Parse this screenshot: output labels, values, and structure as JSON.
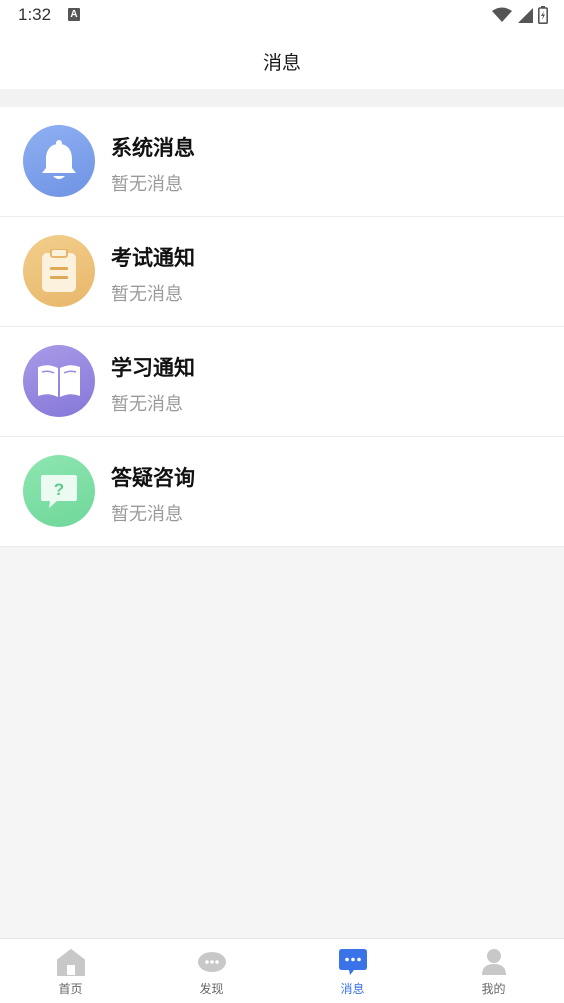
{
  "status_bar": {
    "time": "1:32",
    "notification_icon": "a-notification-icon",
    "icons": [
      "wifi-icon",
      "signal-icon",
      "battery-icon"
    ]
  },
  "header": {
    "title": "消息"
  },
  "messages": [
    {
      "title": "系统消息",
      "subtitle": "暂无消息",
      "icon": "bell-icon",
      "color": "#7b9ee8"
    },
    {
      "title": "考试通知",
      "subtitle": "暂无消息",
      "icon": "clipboard-icon",
      "color": "#edc27a"
    },
    {
      "title": "学习通知",
      "subtitle": "暂无消息",
      "icon": "book-icon",
      "color": "#9386e0"
    },
    {
      "title": "答疑咨询",
      "subtitle": "暂无消息",
      "icon": "question-bubble-icon",
      "color": "#7edfa5"
    }
  ],
  "tabbar": {
    "active_color": "#3a73e8",
    "inactive_color": "#c8c8c8",
    "tabs": [
      {
        "label": "首页",
        "icon": "home-icon",
        "active": false
      },
      {
        "label": "发现",
        "icon": "discover-icon",
        "active": false
      },
      {
        "label": "消息",
        "icon": "message-icon",
        "active": true
      },
      {
        "label": "我的",
        "icon": "profile-icon",
        "active": false
      }
    ]
  }
}
